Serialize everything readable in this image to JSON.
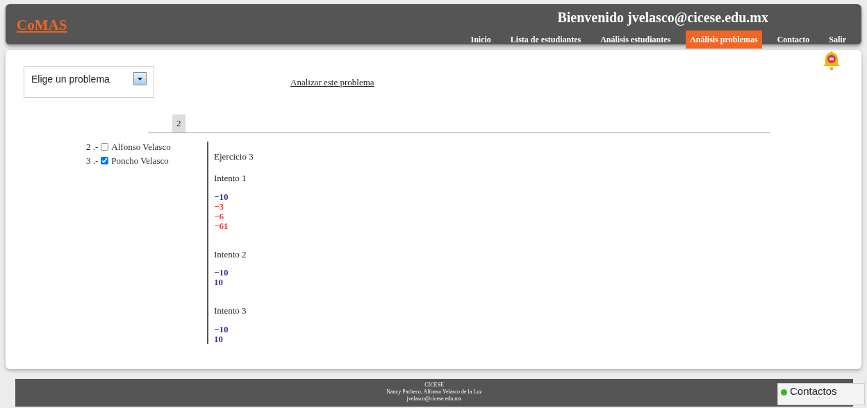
{
  "header": {
    "logo": "CoMAS",
    "welcome": "Bienvenido jvelasco@cicese.edu.mx",
    "nav": [
      {
        "label": "Inicio",
        "selected": false
      },
      {
        "label": "Lista de estudiantes",
        "selected": false
      },
      {
        "label": "Análisis estudiantes",
        "selected": false
      },
      {
        "label": "Análisis problemas",
        "selected": true
      },
      {
        "label": "Contacto",
        "selected": false
      },
      {
        "label": "Salir",
        "selected": false
      }
    ]
  },
  "problem_select": {
    "value": "Elige un problema"
  },
  "analyze_link": "Analizar este problema",
  "tabs": [
    {
      "label": "2",
      "selected": true
    }
  ],
  "students": [
    {
      "number": "2 .-",
      "name": "Alfonso Velasco",
      "checked": false
    },
    {
      "number": "3 .-",
      "name": "Poncho Velasco",
      "checked": true
    }
  ],
  "exercise": {
    "title": "Ejercicio 3",
    "attempts": [
      {
        "label": "Intento 1",
        "answers": [
          {
            "text": "−10",
            "color": "#333399"
          },
          {
            "text": "−3",
            "color": "#ff3333"
          },
          {
            "text": "−6",
            "color": "#ff3333"
          },
          {
            "text": "−61",
            "color": "#ff3333"
          }
        ]
      },
      {
        "label": "Intento 2",
        "answers": [
          {
            "text": "−10",
            "color": "#333399"
          },
          {
            "text": "10",
            "color": "#333399"
          }
        ]
      },
      {
        "label": "Intento 3",
        "answers": [
          {
            "text": "−10",
            "color": "#333399"
          },
          {
            "text": "10",
            "color": "#333399"
          }
        ]
      }
    ]
  },
  "footer": {
    "lines": [
      "CICESE",
      "Nancy Pacheco, Alfonso Velasco de la Luz",
      "jvelasco@cicese.edu.mx"
    ]
  },
  "contacts": {
    "title": "Contactos",
    "online": true
  }
}
